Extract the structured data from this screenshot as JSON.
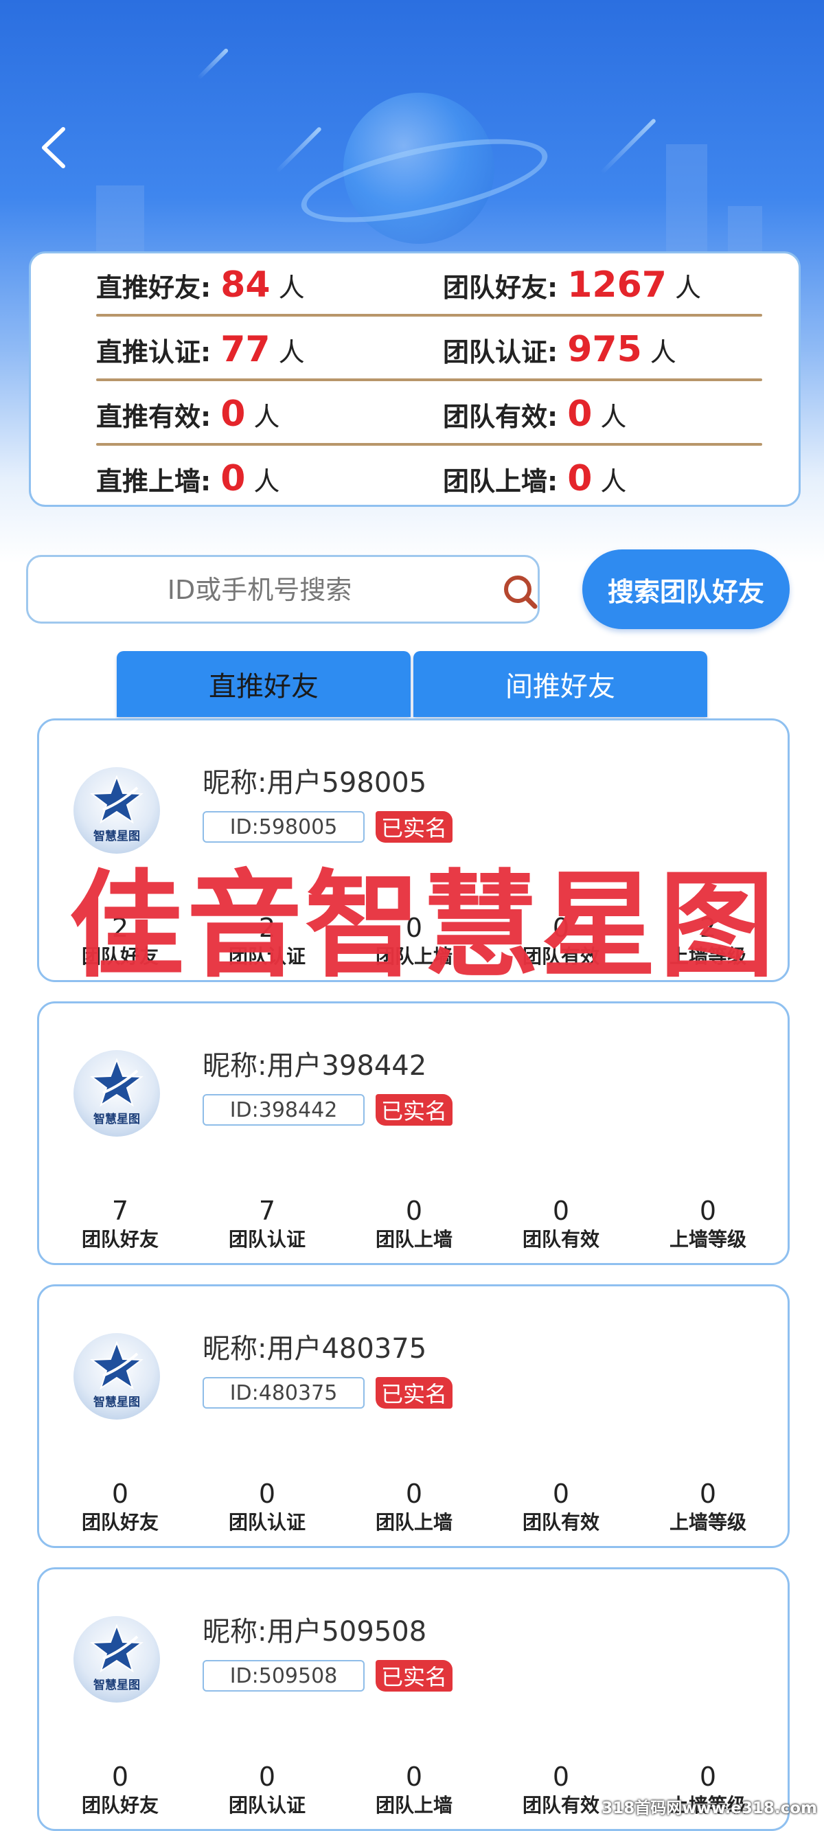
{
  "stats": [
    {
      "left_label": "直推好友:",
      "left_value": "84",
      "right_label": "团队好友:",
      "right_value": "1267",
      "unit": "人"
    },
    {
      "left_label": "直推认证:",
      "left_value": "77",
      "right_label": "团队认证:",
      "right_value": "975",
      "unit": "人"
    },
    {
      "left_label": "直推有效:",
      "left_value": "0",
      "right_label": "团队有效:",
      "right_value": "0",
      "unit": "人"
    },
    {
      "left_label": "直推上墙:",
      "left_value": "0",
      "right_label": "团队上墙:",
      "right_value": "0",
      "unit": "人"
    }
  ],
  "search": {
    "placeholder": "ID或手机号搜索",
    "button_label": "搜索团队好友"
  },
  "tabs": [
    {
      "label": "直推好友",
      "active": true
    },
    {
      "label": "间推好友",
      "active": false
    }
  ],
  "avatar_text": "智慧星图",
  "verified_label": "已实名",
  "metric_labels": [
    "团队好友",
    "团队认证",
    "团队上墙",
    "团队有效",
    "上墙等级"
  ],
  "users": [
    {
      "nickname": "昵称:用户598005",
      "id": "ID:598005",
      "metrics": [
        "2",
        "2",
        "0",
        "0",
        "2"
      ]
    },
    {
      "nickname": "昵称:用户398442",
      "id": "ID:398442",
      "metrics": [
        "7",
        "7",
        "0",
        "0",
        "0"
      ]
    },
    {
      "nickname": "昵称:用户480375",
      "id": "ID:480375",
      "metrics": [
        "0",
        "0",
        "0",
        "0",
        "0"
      ]
    },
    {
      "nickname": "昵称:用户509508",
      "id": "ID:509508",
      "metrics": [
        "0",
        "0",
        "0",
        "0",
        "0"
      ]
    }
  ],
  "watermark": "佳音智慧星图",
  "site_watermark": "318首码网www.e318.com",
  "colors": {
    "accent": "#2e8cf1",
    "highlight": "#e4252b",
    "divider": "#b8966a",
    "border": "#8fc0f0"
  }
}
